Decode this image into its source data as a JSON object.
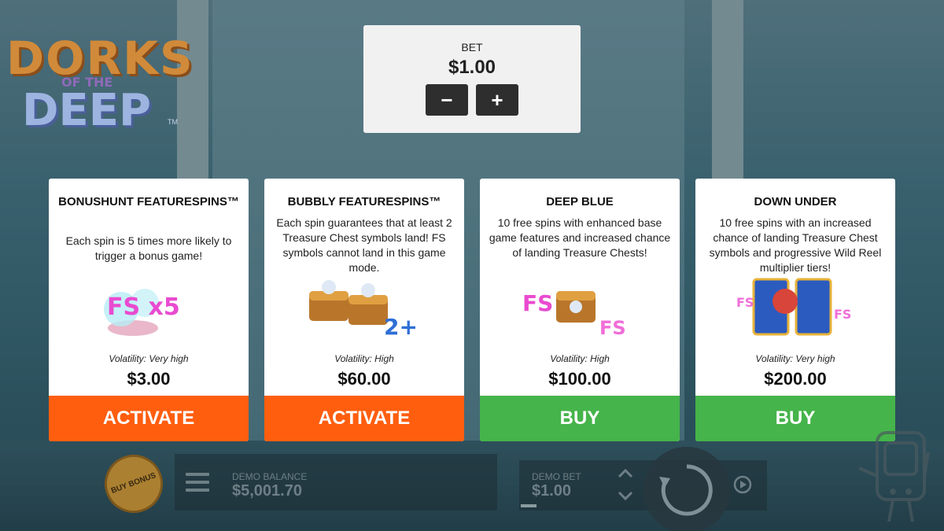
{
  "logo": {
    "line1": "DORKS",
    "line2": "OF THE",
    "line3": "DEEP",
    "trademark": "TM"
  },
  "bet_panel": {
    "label": "BET",
    "value": "$1.00",
    "minus_label": "−",
    "plus_label": "+"
  },
  "cards": [
    {
      "title": "BONUSHUNT FEATURESPINS™",
      "description": "Each spin is 5 times more likely to trigger a bonus game!",
      "art_text": "FS x5",
      "volatility": "Volatility: Very high",
      "price": "$3.00",
      "button": "ACTIVATE"
    },
    {
      "title": "BUBBLY FEATURESPINS™",
      "description": "Each spin guarantees that at least 2 Treasure Chest symbols land! FS symbols cannot land in this game mode.",
      "art_text": "2+",
      "volatility": "Volatility: High",
      "price": "$60.00",
      "button": "ACTIVATE"
    },
    {
      "title": "DEEP BLUE",
      "description": "10 free spins with enhanced base game features and increased chance of landing Treasure Chests!",
      "art_text": "FS",
      "volatility": "Volatility: High",
      "price": "$100.00",
      "button": "BUY"
    },
    {
      "title": "DOWN UNDER",
      "description": "10 free spins with an increased chance of landing Treasure Chest symbols and progressive Wild Reel multiplier tiers!",
      "art_text": "FS",
      "volatility": "Volatility: Very high",
      "price": "$200.00",
      "button": "BUY"
    }
  ],
  "bottom_bar": {
    "buy_bonus_label": "BUY BONUS",
    "balance_label": "DEMO BALANCE",
    "balance_value": "$5,001.70",
    "bet_label": "DEMO BET",
    "bet_value": "$1.00"
  },
  "colors": {
    "activate": "#ff5e0f",
    "buy": "#45b44a",
    "panel": "#f1f1f1"
  },
  "icons": [
    "menu-icon",
    "arrow-up-icon",
    "arrow-down-icon",
    "spin-icon",
    "autoplay-icon",
    "mascot-icon"
  ]
}
